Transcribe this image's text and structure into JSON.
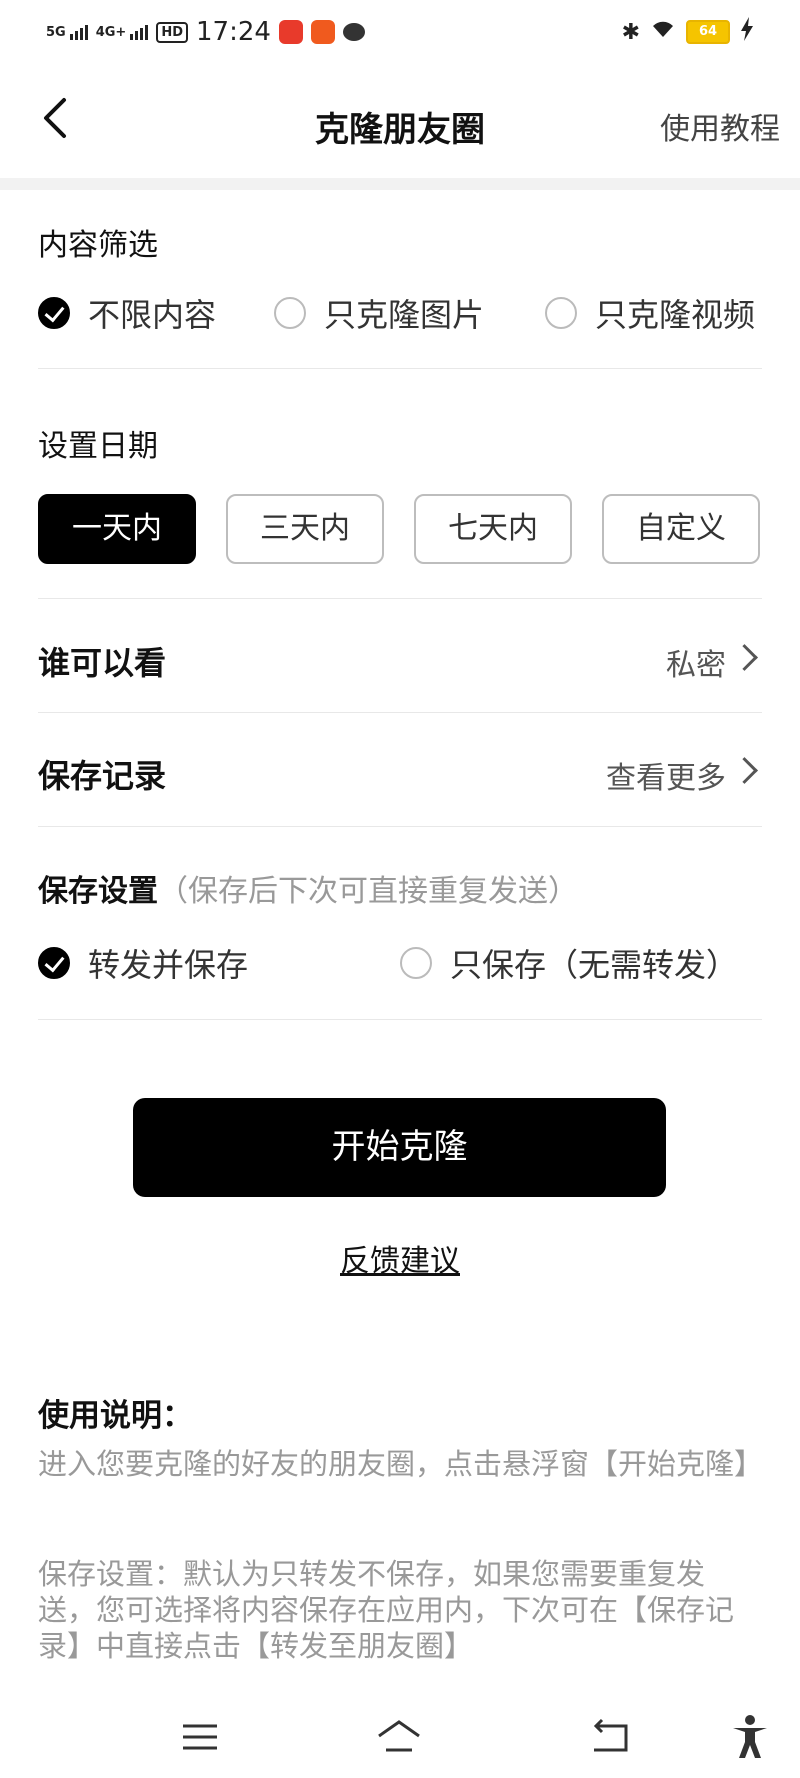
{
  "status_bar": {
    "time": "17:24",
    "network1": "5G",
    "network2": "4G+",
    "hd": "HD",
    "battery": "64"
  },
  "nav": {
    "title": "克隆朋友圈",
    "tutorial": "使用教程"
  },
  "content_filter": {
    "title": "内容筛选",
    "options": [
      {
        "label": "不限内容",
        "checked": true
      },
      {
        "label": "只克隆图片",
        "checked": false
      },
      {
        "label": "只克隆视频",
        "checked": false
      }
    ]
  },
  "date": {
    "title": "设置日期",
    "options": [
      {
        "label": "一天内",
        "selected": true
      },
      {
        "label": "三天内",
        "selected": false
      },
      {
        "label": "七天内",
        "selected": false
      },
      {
        "label": "自定义",
        "selected": false
      }
    ]
  },
  "visibility": {
    "label": "谁可以看",
    "value": "私密"
  },
  "records": {
    "label": "保存记录",
    "value": "查看更多"
  },
  "save_settings": {
    "title": "保存设置",
    "hint": "（保存后下次可直接重复发送）",
    "options": [
      {
        "label": "转发并保存",
        "checked": true
      },
      {
        "label": "只保存（无需转发）",
        "checked": false
      }
    ]
  },
  "start_button": "开始克隆",
  "feedback": "反馈建议",
  "instructions": {
    "title": "使用说明：",
    "p1": "进入您要克隆的好友的朋友圈，点击悬浮窗【开始克隆】",
    "p2": "保存设置：默认为只转发不保存，如果您需要重复发送，您可选择将内容保存在应用内，下次可在【保存记录】中直接点击【转发至朋友圈】"
  }
}
